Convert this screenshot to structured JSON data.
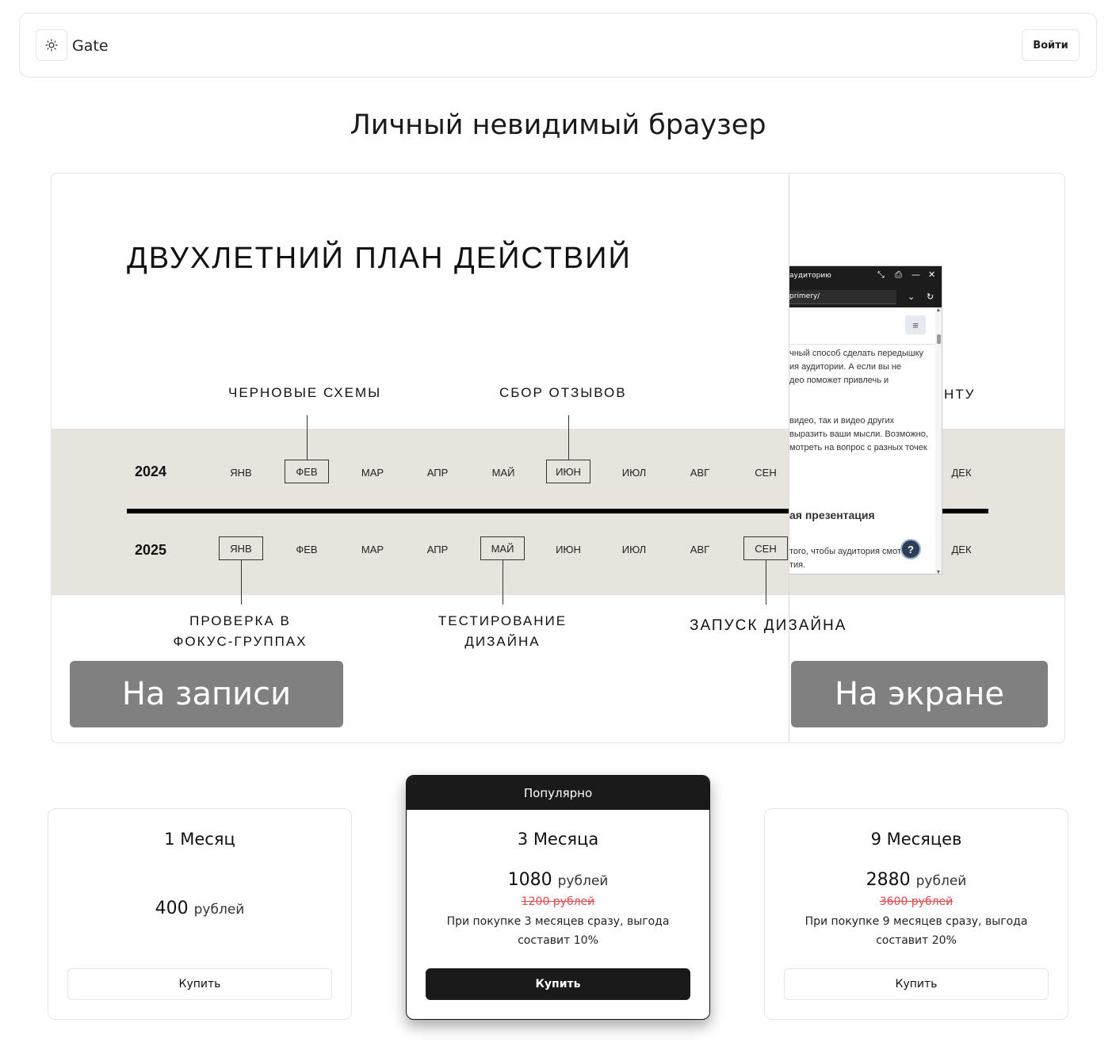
{
  "header": {
    "brand": "Gate",
    "login_label": "Войти",
    "theme_icon": "sun-icon"
  },
  "page_title": "Личный невидимый браузер",
  "demo": {
    "slide_title": "ДВУХЛЕТНИЙ ПЛАН ДЕЙСТВИЙ",
    "year_1": "2024",
    "year_2": "2025",
    "months": [
      "ЯНВ",
      "ФЕВ",
      "МАР",
      "АПР",
      "МАЙ",
      "ИЮН",
      "ИЮЛ",
      "АВГ",
      "СЕН",
      "ДЕК"
    ],
    "label_drafts": "ЧЕРНОВЫЕ СХЕМЫ",
    "label_feedback": "СБОР ОТЗЫВОВ",
    "label_partial_right": "НТУ",
    "label_focus_1": "ПРОВЕРКА В",
    "label_focus_2": "ФОКУС-ГРУППАХ",
    "label_testing_1": "ТЕСТИРОВАНИЕ",
    "label_testing_2": "ДИЗАЙНА",
    "label_launch": "ЗАПУСК ДИЗАЙНА",
    "overlay_recording": "На записи",
    "overlay_screen": "На экране",
    "floating_window": {
      "title": "аудиторию",
      "url": "primery/",
      "text_lines_1": [
        "чный способ сделать передышку",
        "ия аудитории. А если вы не",
        "део поможет привлечь и"
      ],
      "text_lines_2": [
        "видео, так и видео других",
        "выразить ваши мысли. Возможно,",
        "мотреть на вопрос с разных точек"
      ],
      "heading": "ая презентация",
      "text_lines_3": [
        "того, чтобы аудитория смот",
        "тия."
      ],
      "help_label": "?"
    }
  },
  "pricing": {
    "plans": [
      {
        "name": "1 Месяц",
        "price": "400",
        "currency": "рублей",
        "buy_label": "Купить"
      },
      {
        "badge": "Популярно",
        "name": "3 Месяца",
        "price": "1080",
        "currency": "рублей",
        "old_price": "1200 рублей",
        "note": "При покупке 3 месяцев сразу, выгода составит 10%",
        "buy_label": "Купить"
      },
      {
        "name": "9 Месяцев",
        "price": "2880",
        "currency": "рублей",
        "old_price": "3600 рублей",
        "note": "При покупке 9 месяцев сразу, выгода составит 20%",
        "buy_label": "Купить"
      }
    ]
  }
}
